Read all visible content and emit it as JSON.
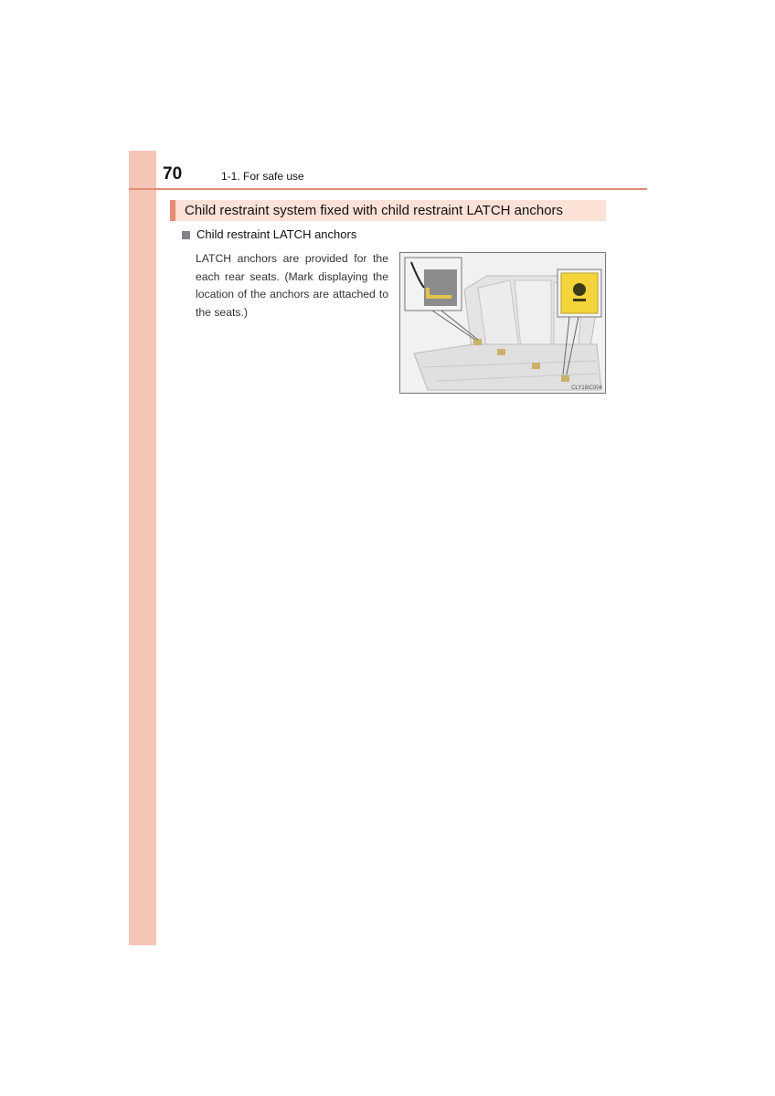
{
  "header": {
    "page_number": "70",
    "section": "1-1. For safe use"
  },
  "content": {
    "title": "Child restraint system fixed with child restraint LATCH anchors",
    "subheading": "Child restraint LATCH anchors",
    "body": "LATCH anchors are provided for the each rear seats. (Mark displaying the location of the anchors are attached to the seats.)",
    "figure": {
      "description": "rear seat illustration with LATCH anchor locations",
      "code": "CLY18IC004",
      "colors": {
        "mark": "#f3d43a",
        "anchor": "#c9b26a"
      }
    }
  },
  "theme": {
    "accent": "#e48b76",
    "tab": "#f4c6b6",
    "title_bg": "#fbe1d6"
  }
}
